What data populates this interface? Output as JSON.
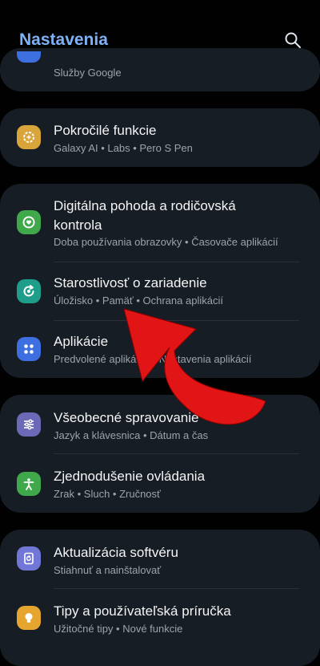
{
  "header": {
    "title": "Nastavenia"
  },
  "groups": {
    "google": {
      "subtitle": "Služby Google"
    },
    "advanced": {
      "title": "Pokročilé funkcie",
      "subtitle": "Galaxy AI • Labs • Pero S Pen"
    },
    "wellbeing": {
      "title1": "Digitálna pohoda a rodičovská",
      "title2": "kontrola",
      "subtitle": "Doba používania obrazovky • Časovače aplikácií"
    },
    "device_care": {
      "title": "Starostlivosť o zariadenie",
      "subtitle": "Úložisko • Pamäť • Ochrana aplikácií"
    },
    "apps": {
      "title": "Aplikácie",
      "subtitle": "Predvolené aplikácie • Nastavenia aplikácií"
    },
    "general": {
      "title": "Všeobecné spravovanie",
      "subtitle": "Jazyk a klávesnica • Dátum a čas"
    },
    "accessibility": {
      "title": "Zjednodušenie ovládania",
      "subtitle": "Zrak • Sluch • Zručnosť"
    },
    "update": {
      "title": "Aktualizácia softvéru",
      "subtitle": "Stiahnuť a nainštalovať"
    },
    "tips": {
      "title": "Tipy a používateľská príručka",
      "subtitle": "Užitočné tipy • Nové funkcie"
    }
  },
  "colors": {
    "accent": "#7eb2f7",
    "advanced_icon": "#d9a43a",
    "wellbeing_icon": "#3fa84b",
    "device_care_icon": "#1e9d8a",
    "apps_icon": "#3d6fe0",
    "general_icon": "#6c6ab8",
    "accessibility_icon": "#3fa84b",
    "update_icon": "#7177d6",
    "tips_icon": "#e6a52e",
    "annotation_arrow": "#e11515"
  },
  "icons": {
    "search": "search-icon",
    "advanced": "sparkle-gear-icon",
    "wellbeing": "heart-clock-icon",
    "device_care": "refresh-care-icon",
    "apps": "apps-grid-icon",
    "general": "sliders-icon",
    "accessibility": "person-icon",
    "update": "update-icon",
    "tips": "bulb-icon"
  }
}
